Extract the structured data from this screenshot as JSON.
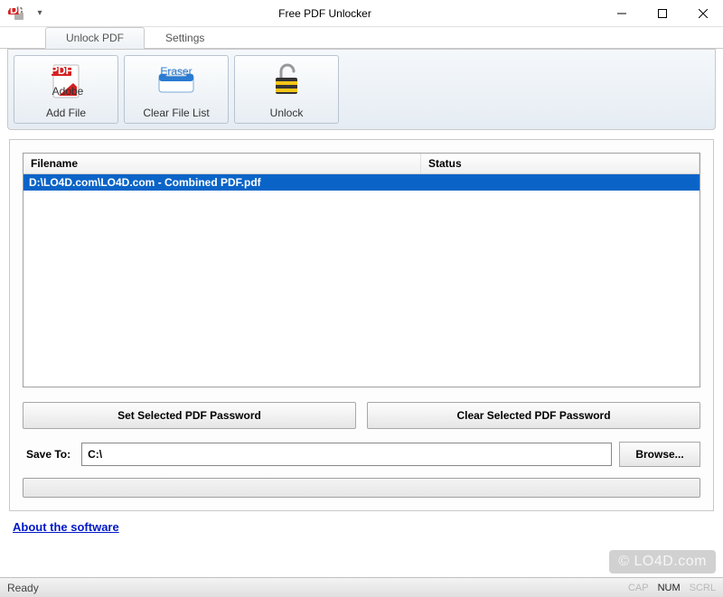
{
  "window": {
    "title": "Free PDF Unlocker"
  },
  "tabs": {
    "unlock": "Unlock PDF",
    "settings": "Settings"
  },
  "ribbon": {
    "add_file": "Add File",
    "clear_list": "Clear File List",
    "unlock": "Unlock"
  },
  "list": {
    "col_filename": "Filename",
    "col_status": "Status",
    "rows": [
      {
        "filename": "D:\\LO4D.com\\LO4D.com - Combined PDF.pdf",
        "status": ""
      }
    ]
  },
  "buttons": {
    "set_password": "Set Selected PDF Password",
    "clear_password": "Clear Selected PDF Password",
    "browse": "Browse..."
  },
  "save": {
    "label": "Save To:",
    "value": "C:\\"
  },
  "link": {
    "about": "About the software"
  },
  "status": {
    "ready": "Ready",
    "cap": "CAP",
    "num": "NUM",
    "scrl": "SCRL"
  },
  "watermark": "© LO4D.com"
}
